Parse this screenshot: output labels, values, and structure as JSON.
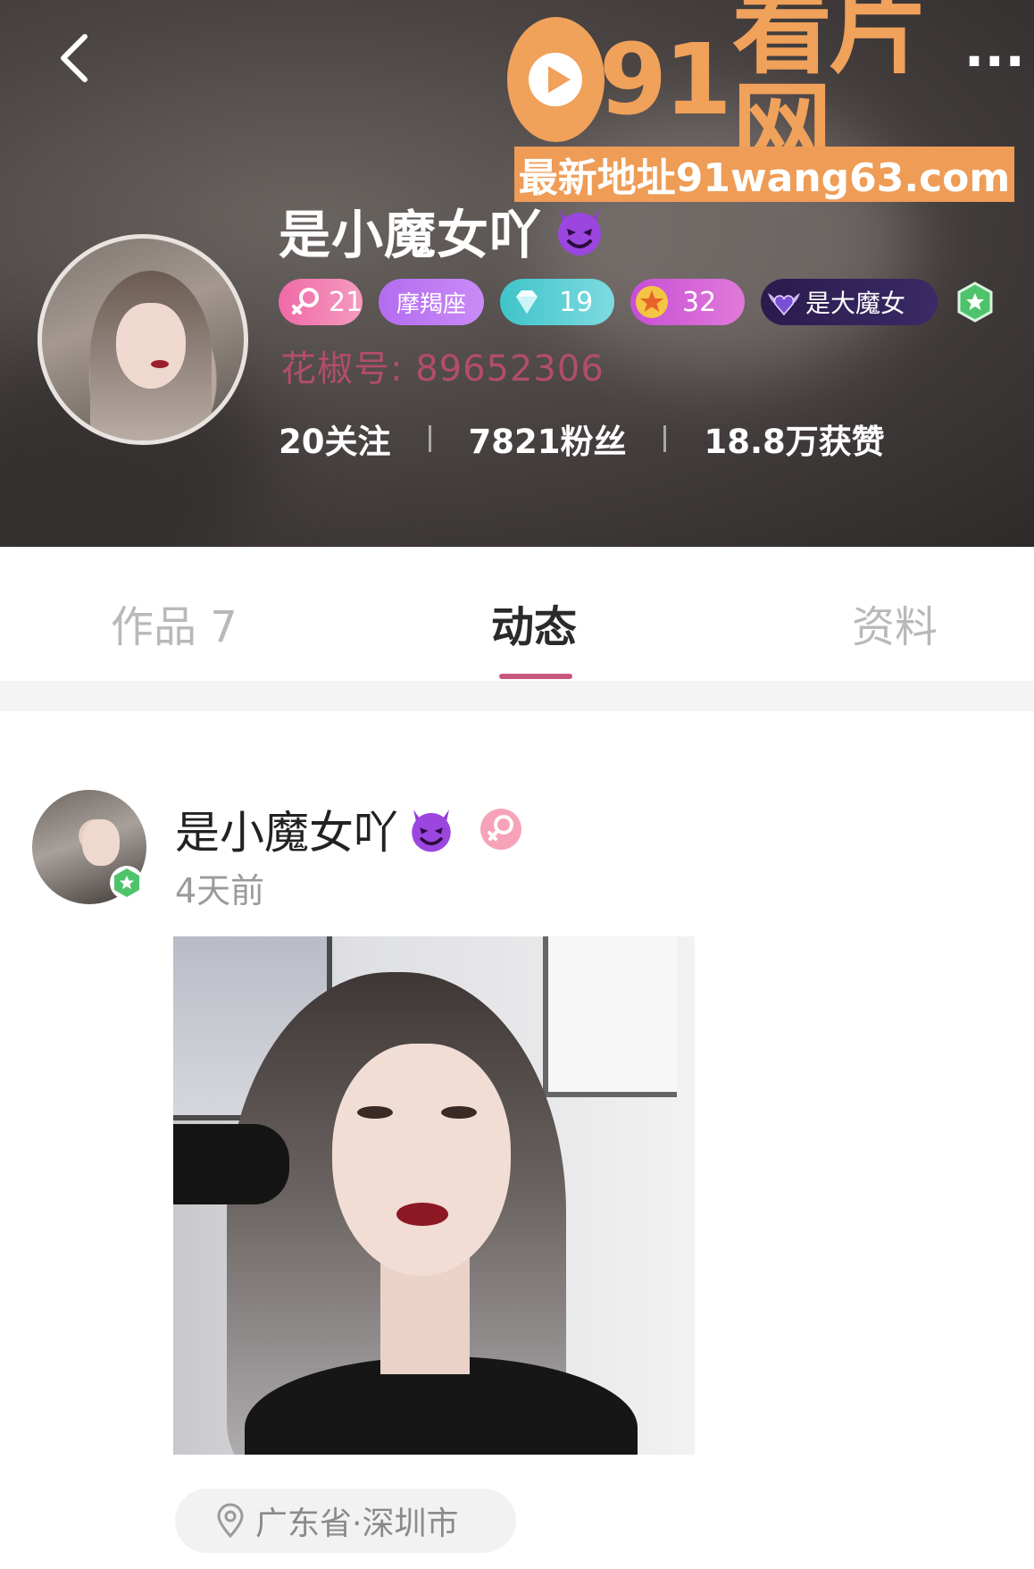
{
  "header": {
    "back_icon": "chevron-left-icon",
    "nickname": "是小魔女吖",
    "nickname_emoji": "devil-icon",
    "badges": {
      "gender_age": "21",
      "zodiac": "摩羯座",
      "diamond_level": "19",
      "star_level": "32",
      "title": "是大魔女"
    },
    "huajiao_id": "花椒号: 89652306",
    "stats": {
      "following": "20关注",
      "fans": "7821粉丝",
      "likes": "18.8万获赞"
    },
    "colors": {
      "id_text": "#b24d6b",
      "accent": "#c8577e"
    }
  },
  "watermark": {
    "brand": "看片网",
    "brand_prefix": "91",
    "more": "···",
    "url_text": "最新地址91wang63.com",
    "color": "#f0a15a"
  },
  "tabs": [
    {
      "label": "作品 7",
      "active": false
    },
    {
      "label": "动态",
      "active": true
    },
    {
      "label": "资料",
      "active": false
    }
  ],
  "post": {
    "author": "是小魔女吖",
    "time": "4天前",
    "location": "广东省·深圳市"
  }
}
